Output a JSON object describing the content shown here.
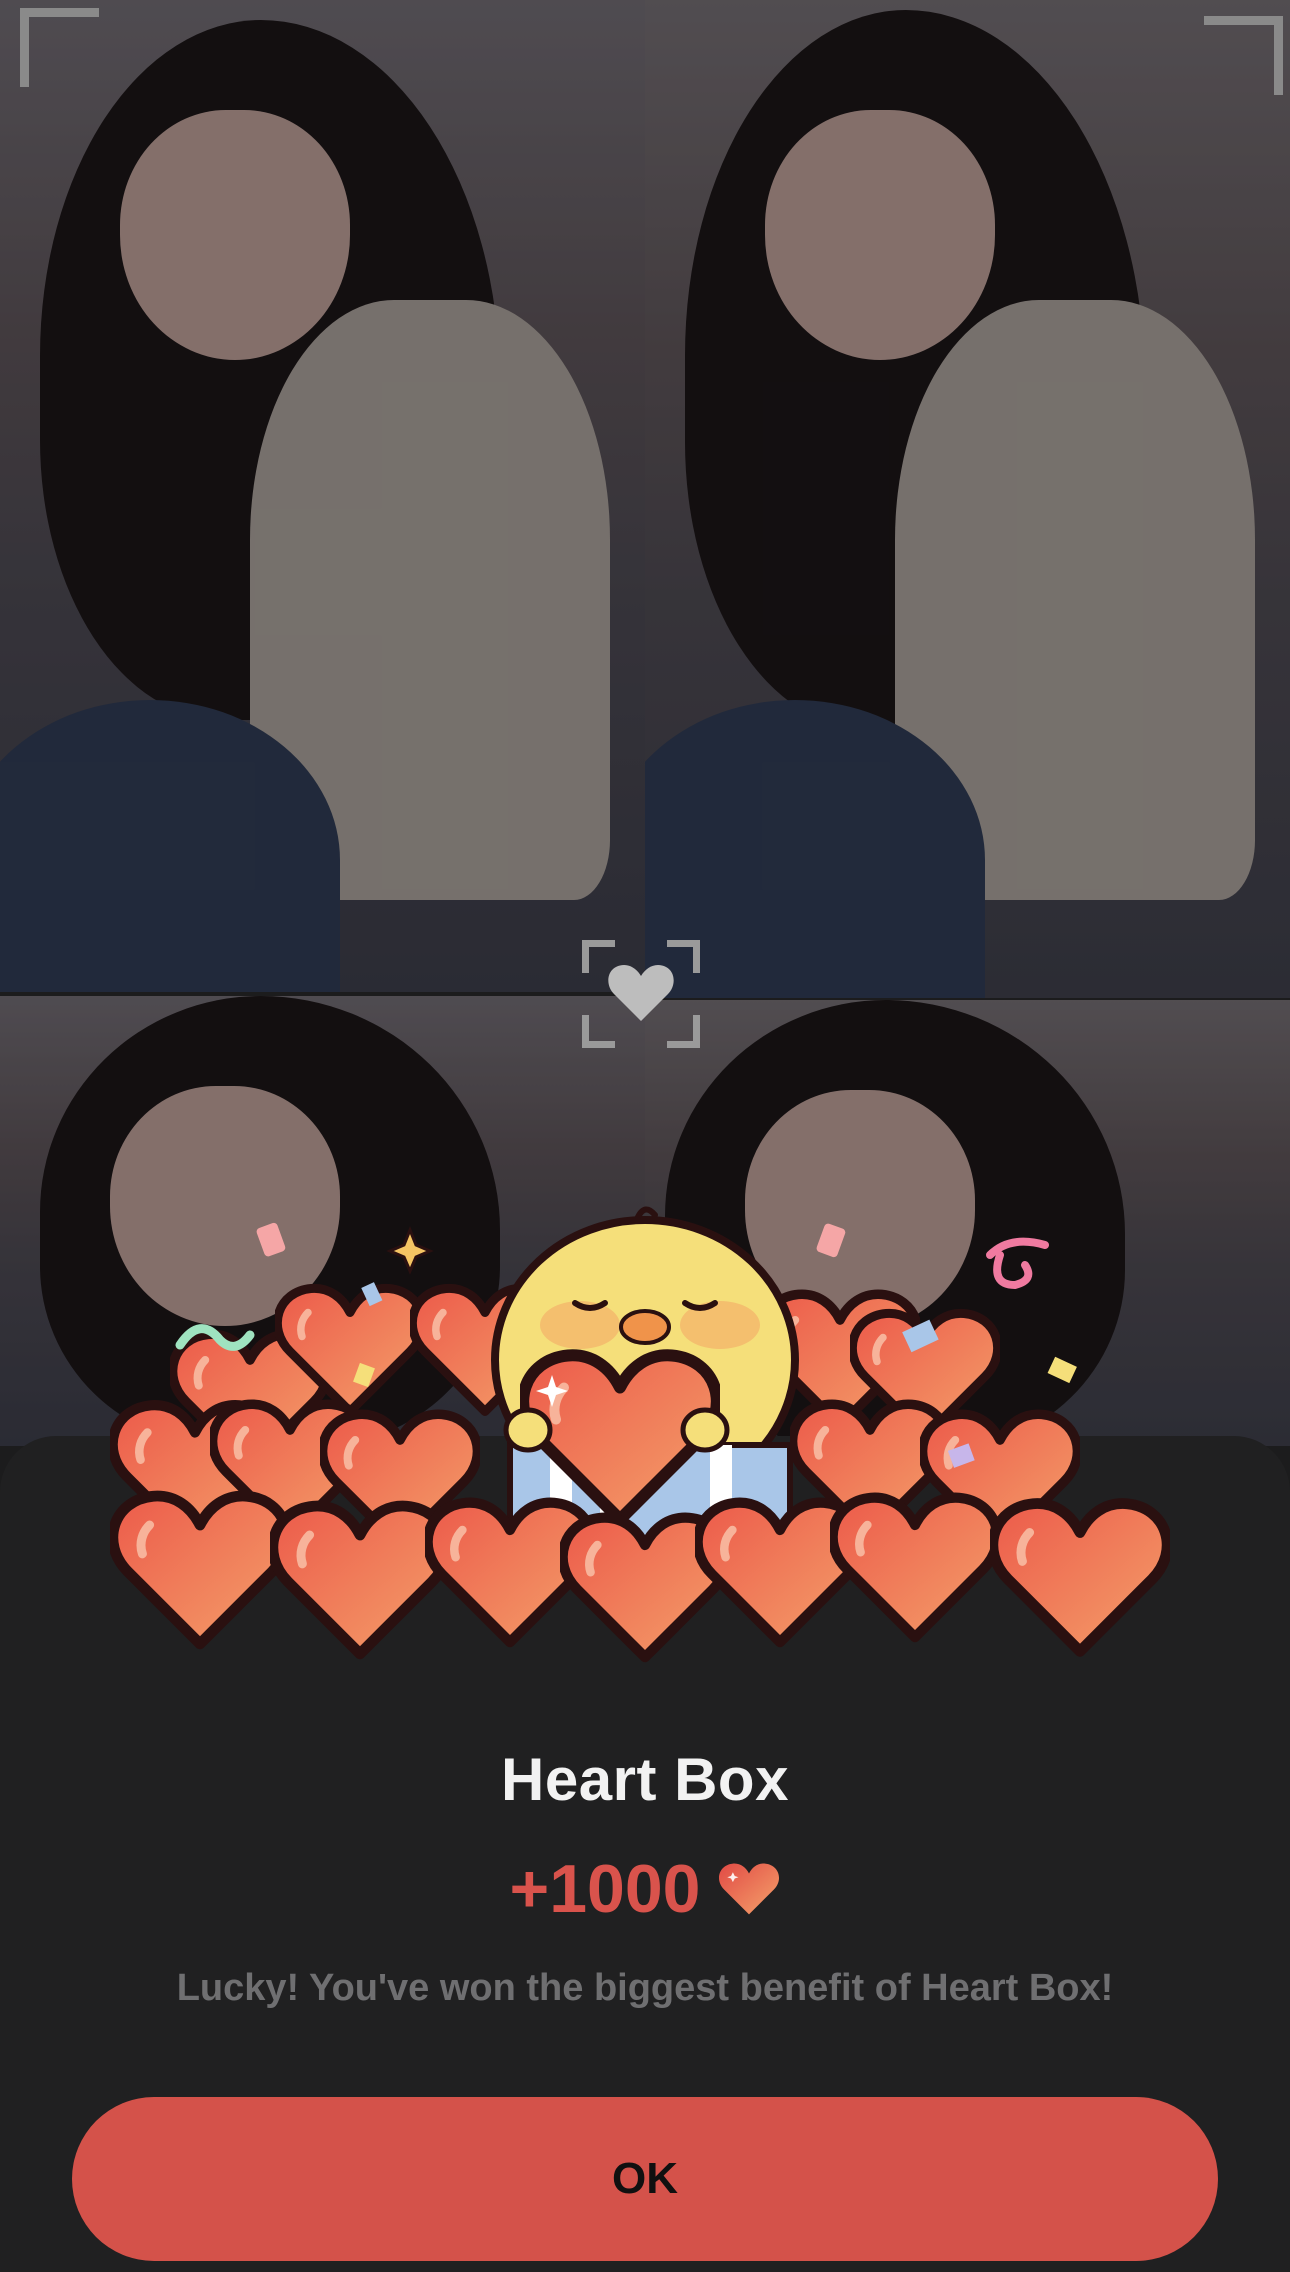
{
  "modal": {
    "title": "Heart Box",
    "reward_amount": "+1000",
    "reward_icon": "heart-icon",
    "message": "Lucky! You've won the biggest benefit of Heart Box!",
    "ok_label": "OK"
  },
  "colors": {
    "accent": "#d4524a",
    "reward_text": "#d9534c",
    "sheet_background": "#202021",
    "title_text": "#f2f2f2",
    "message_text": "#6f6f71"
  },
  "background": {
    "photos": [
      "portrait-photo",
      "portrait-photo",
      "portrait-photo",
      "portrait-photo"
    ],
    "center_icon": "heart-frame-icon"
  }
}
